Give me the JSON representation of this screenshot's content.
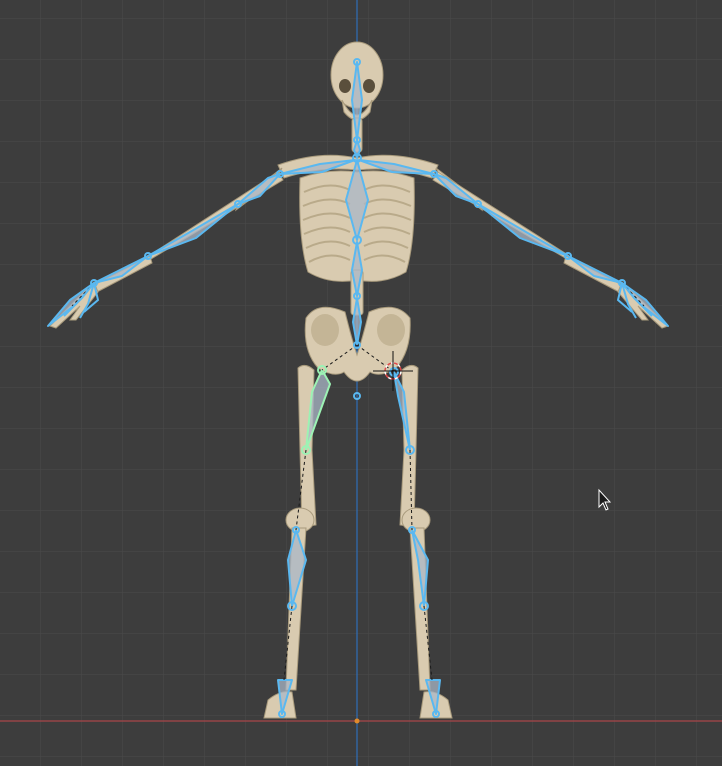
{
  "viewport": {
    "background": "#3d3d3d",
    "grid_color": "#4a4a4a",
    "axis_vertical_color": "#2f6fb8",
    "axis_horizontal_color": "#a8464a"
  },
  "scene": {
    "bone_color": "#d9cbb0",
    "bone_shadow": "#a89a7c",
    "rig_color": "#5ab8f0",
    "rig_fill": "#a9b7c7",
    "rig_selected": "#9cf2b4",
    "cursor_3d_colors": [
      "#e04a4a",
      "#ffffff"
    ],
    "mouse_cursor": "arrow-pointer"
  }
}
